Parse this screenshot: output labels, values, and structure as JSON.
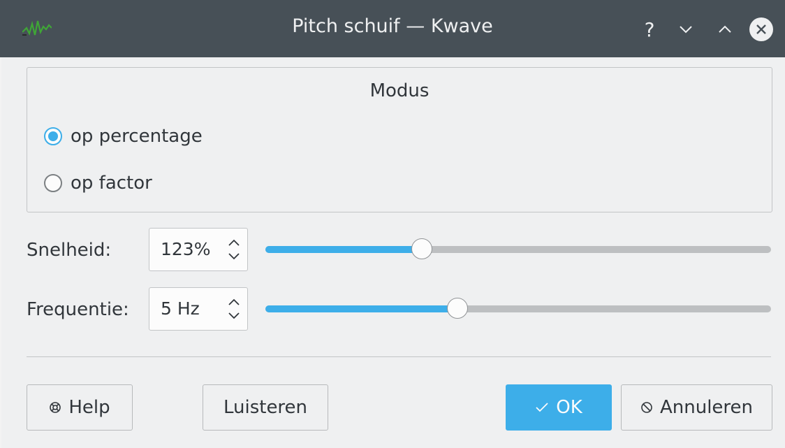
{
  "window": {
    "title": "Pitch schuif — Kwave",
    "app_icon": "kwave-waveform-icon",
    "controls": {
      "help_label": "?",
      "minimize_icon": "chevron-down-icon",
      "maximize_icon": "chevron-up-icon",
      "close_icon": "close-icon"
    }
  },
  "mode_group": {
    "title": "Modus",
    "options": [
      {
        "label": "op percentage",
        "checked": true
      },
      {
        "label": "op factor",
        "checked": false
      }
    ]
  },
  "speed": {
    "label": "Snelheid:",
    "value": "123%",
    "slider_fraction": 0.31
  },
  "frequency": {
    "label": "Frequentie:",
    "value": "5 Hz",
    "slider_fraction": 0.38
  },
  "buttons": {
    "help": "Help",
    "listen": "Luisteren",
    "ok": "OK",
    "cancel": "Annuleren"
  },
  "colors": {
    "accent": "#3daee9",
    "titlebar": "#475057",
    "background": "#eff0f1"
  }
}
